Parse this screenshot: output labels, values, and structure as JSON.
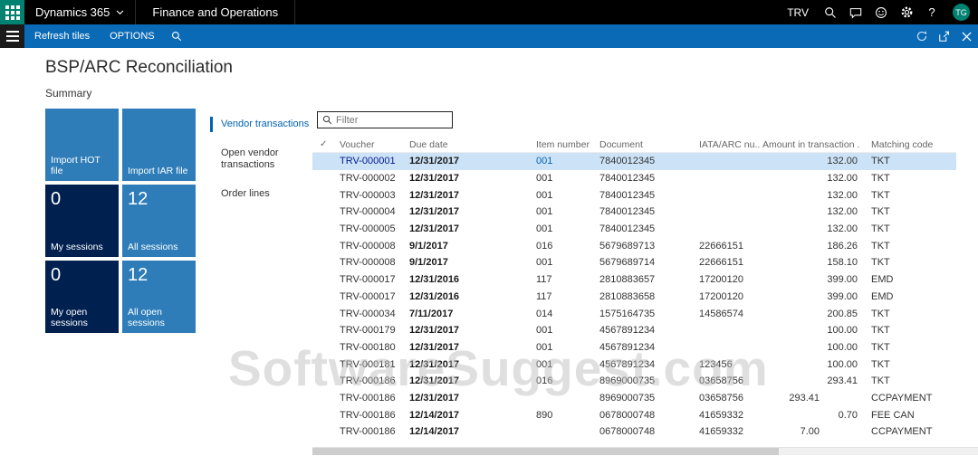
{
  "top_bar": {
    "app_name": "Dynamics 365",
    "module_name": "Finance and Operations",
    "company": "TRV",
    "avatar_initials": "TG"
  },
  "action_bar": {
    "refresh_tiles_label": "Refresh tiles",
    "options_label": "OPTIONS"
  },
  "page": {
    "title": "BSP/ARC Reconciliation",
    "section_label": "Summary"
  },
  "tiles": [
    {
      "label": "Import HOT file",
      "count": ""
    },
    {
      "label": "Import IAR file",
      "count": ""
    },
    {
      "label": "My sessions",
      "count": "0"
    },
    {
      "label": "All sessions",
      "count": "12"
    },
    {
      "label": "My open sessions",
      "count": "0"
    },
    {
      "label": "All open sessions",
      "count": "12"
    }
  ],
  "nav": {
    "items": [
      {
        "label": "Vendor transactions",
        "active": true
      },
      {
        "label": "Open vendor transactions",
        "active": false
      },
      {
        "label": "Order lines",
        "active": false
      }
    ]
  },
  "grid": {
    "filter_placeholder": "Filter",
    "select_all": "✓",
    "columns": [
      "Voucher",
      "Due date",
      "Item number",
      "Document",
      "IATA/ARC nu...",
      "Amount in transaction ...",
      "Matching code"
    ],
    "rows": [
      {
        "voucher": "TRV-000001",
        "due_date": "12/31/2017",
        "item_number": "001",
        "document": "7840012345",
        "iata_arc": "",
        "amount_tx": "",
        "amount": "132.00",
        "matching_code": "TKT",
        "selected": true
      },
      {
        "voucher": "TRV-000002",
        "due_date": "12/31/2017",
        "item_number": "001",
        "document": "7840012345",
        "iata_arc": "",
        "amount_tx": "",
        "amount": "132.00",
        "matching_code": "TKT",
        "selected": false
      },
      {
        "voucher": "TRV-000003",
        "due_date": "12/31/2017",
        "item_number": "001",
        "document": "7840012345",
        "iata_arc": "",
        "amount_tx": "",
        "amount": "132.00",
        "matching_code": "TKT",
        "selected": false
      },
      {
        "voucher": "TRV-000004",
        "due_date": "12/31/2017",
        "item_number": "001",
        "document": "7840012345",
        "iata_arc": "",
        "amount_tx": "",
        "amount": "132.00",
        "matching_code": "TKT",
        "selected": false
      },
      {
        "voucher": "TRV-000005",
        "due_date": "12/31/2017",
        "item_number": "001",
        "document": "7840012345",
        "iata_arc": "",
        "amount_tx": "",
        "amount": "132.00",
        "matching_code": "TKT",
        "selected": false
      },
      {
        "voucher": "TRV-000008",
        "due_date": "9/1/2017",
        "item_number": "016",
        "document": "5679689713",
        "iata_arc": "22666151",
        "amount_tx": "",
        "amount": "186.26",
        "matching_code": "TKT",
        "selected": false
      },
      {
        "voucher": "TRV-000008",
        "due_date": "9/1/2017",
        "item_number": "001",
        "document": "5679689714",
        "iata_arc": "22666151",
        "amount_tx": "",
        "amount": "158.10",
        "matching_code": "TKT",
        "selected": false
      },
      {
        "voucher": "TRV-000017",
        "due_date": "12/31/2016",
        "item_number": "117",
        "document": "2810883657",
        "iata_arc": "17200120",
        "amount_tx": "",
        "amount": "399.00",
        "matching_code": "EMD",
        "selected": false
      },
      {
        "voucher": "TRV-000017",
        "due_date": "12/31/2016",
        "item_number": "117",
        "document": "2810883658",
        "iata_arc": "17200120",
        "amount_tx": "",
        "amount": "399.00",
        "matching_code": "EMD",
        "selected": false
      },
      {
        "voucher": "TRV-000034",
        "due_date": "7/11/2017",
        "item_number": "014",
        "document": "1575164735",
        "iata_arc": "14586574",
        "amount_tx": "",
        "amount": "200.85",
        "matching_code": "TKT",
        "selected": false
      },
      {
        "voucher": "TRV-000179",
        "due_date": "12/31/2017",
        "item_number": "001",
        "document": "4567891234",
        "iata_arc": "",
        "amount_tx": "",
        "amount": "100.00",
        "matching_code": "TKT",
        "selected": false
      },
      {
        "voucher": "TRV-000180",
        "due_date": "12/31/2017",
        "item_number": "001",
        "document": "4567891234",
        "iata_arc": "",
        "amount_tx": "",
        "amount": "100.00",
        "matching_code": "TKT",
        "selected": false
      },
      {
        "voucher": "TRV-000181",
        "due_date": "12/31/2017",
        "item_number": "001",
        "document": "4567891234",
        "iata_arc": "123456",
        "amount_tx": "",
        "amount": "100.00",
        "matching_code": "TKT",
        "selected": false
      },
      {
        "voucher": "TRV-000186",
        "due_date": "12/31/2017",
        "item_number": "016",
        "document": "8969000735",
        "iata_arc": "03658756",
        "amount_tx": "",
        "amount": "293.41",
        "matching_code": "TKT",
        "selected": false
      },
      {
        "voucher": "TRV-000186",
        "due_date": "12/31/2017",
        "item_number": "",
        "document": "8969000735",
        "iata_arc": "03658756",
        "amount_tx": "293.41",
        "amount": "",
        "matching_code": "CCPAYMENT",
        "selected": false
      },
      {
        "voucher": "TRV-000186",
        "due_date": "12/14/2017",
        "item_number": "890",
        "document": "0678000748",
        "iata_arc": "41659332",
        "amount_tx": "",
        "amount": "0.70",
        "matching_code": "FEE CAN",
        "selected": false
      },
      {
        "voucher": "TRV-000186",
        "due_date": "12/14/2017",
        "item_number": "",
        "document": "0678000748",
        "iata_arc": "41659332",
        "amount_tx": "7.00",
        "amount": "",
        "matching_code": "CCPAYMENT",
        "selected": false
      }
    ]
  },
  "watermark": "SoftwareSuggest.com",
  "colors": {
    "accent": "#0063B1",
    "top_bar_bg": "#000000",
    "brand_teal": "#008272",
    "action_bar_bg": "#0A6AB6",
    "tile_blue": "#2E7DB9",
    "tile_dark": "#002050",
    "selected_row_bg": "#CCE3F7"
  }
}
